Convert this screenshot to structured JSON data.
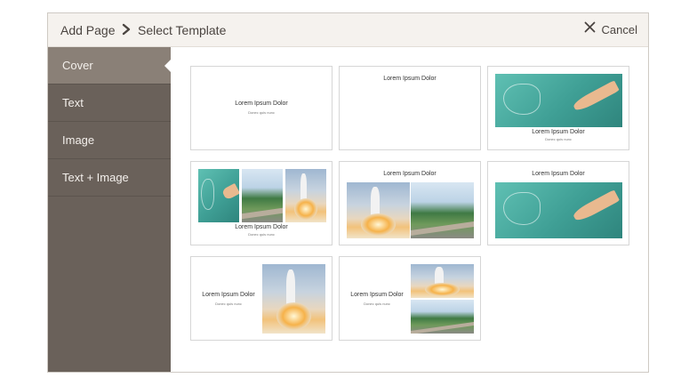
{
  "header": {
    "crumb_root": "Add Page",
    "crumb_current": "Select Template",
    "cancel_label": "Cancel",
    "cancel_icon": "close-icon",
    "separator_icon": "chevron-right-icon"
  },
  "sidebar": {
    "items": [
      {
        "label": "Cover",
        "active": true
      },
      {
        "label": "Text",
        "active": false
      },
      {
        "label": "Image",
        "active": false
      },
      {
        "label": "Text + Image",
        "active": false
      }
    ]
  },
  "templates": {
    "title": "Lorem Ipsum Dolor",
    "subtitle": "Donec quis nunc"
  },
  "colors": {
    "sidebar_bg": "#6a615a",
    "sidebar_active_bg": "#8a8077",
    "header_bg": "#f5f2ee"
  }
}
